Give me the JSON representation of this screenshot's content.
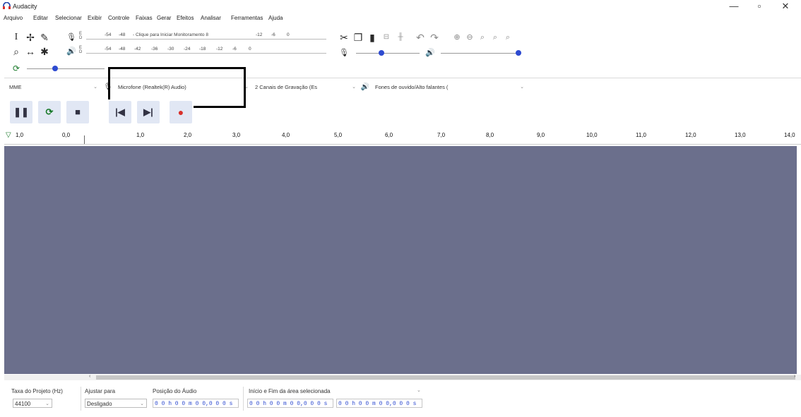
{
  "window": {
    "title": "Audacity",
    "minimize": "—",
    "maximize": "▫",
    "close": "✕"
  },
  "menu": [
    "Arquivo",
    "Editar",
    "Selecionar",
    "Exibir",
    "Controle",
    "Faixas",
    "Gerar",
    "Efeitos",
    "Analisar",
    "Ferramentas",
    "Ajuda"
  ],
  "record_meter": {
    "lr": "E\nD",
    "ticks": [
      "-54",
      "-48",
      "- Clique para Iniciar Monitoramento 8",
      "-12",
      "-6",
      "0"
    ]
  },
  "play_meter": {
    "lr": "E\nD",
    "ticks": [
      "-54",
      "-48",
      "-42",
      "-36",
      "-30",
      "-24",
      "-18",
      "-12",
      "-6",
      "0"
    ]
  },
  "device": {
    "host": "MME",
    "input": "Microfone (Realtek(R) Audio)",
    "channels": "2 Canais de Gravação (Es",
    "output": "Fones de ouvido/Alto falantes ("
  },
  "ruler": {
    "labels": [
      "1,0",
      "0,0",
      "1,0",
      "2,0",
      "3,0",
      "4,0",
      "5,0",
      "6,0",
      "7,0",
      "8,0",
      "9,0",
      "10,0",
      "11,0",
      "12,0",
      "13,0",
      "14,0"
    ]
  },
  "status": {
    "rate_label": "Taxa do Projeto (Hz)",
    "rate_value": "44100",
    "snap_label": "Ajustar para",
    "snap_value": "Desligado",
    "pos_label": "Posição do Áudio",
    "pos_value": "0 0 h 0 0 m 0 0,0 0 0 s",
    "sel_label": "Início e Fim da área selecionada",
    "sel_start": "0 0 h 0 0 m 0 0,0 0 0 s",
    "sel_end": "0 0 h 0 0 m 0 0,0 0 0 s"
  },
  "colors": {
    "track_bg": "#6b6f8c",
    "record": "#d8302b",
    "accent": "#2d4ad0",
    "highlight": "#000000"
  }
}
